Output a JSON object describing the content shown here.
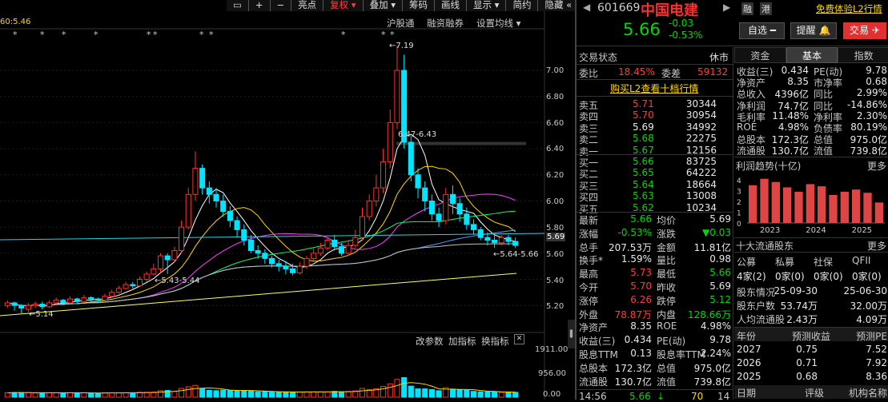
{
  "toolbar": {
    "items": [
      "亮点",
      "复权",
      "叠加",
      "筹码",
      "画线",
      "显示",
      "简约",
      "隐藏"
    ],
    "ma_label": "60:5.46"
  },
  "chart_labels": {
    "high": "7.19",
    "mid": "6.47-6.43",
    "low1": "5.43-5.44",
    "low_price": "5.14",
    "cur_range": "5.64-5.66",
    "current": "5.69"
  },
  "price_axis": [
    "7.00",
    "6.80",
    "6.60",
    "6.40",
    "6.20",
    "6.00",
    "5.80",
    "5.60",
    "5.40",
    "5.20"
  ],
  "vol_axis": [
    "1911.00",
    "956.00",
    "0.00"
  ],
  "right_tabs": [
    "沪股通",
    "融资融券",
    "设置均线"
  ],
  "bottom_tabs": [
    "改参数",
    "加指标",
    "换指标"
  ],
  "stock": {
    "code": "601669",
    "name": "中国电建",
    "price": "5.66",
    "change": "-0.03",
    "pct": "-0.53%",
    "badges": [
      "融",
      "港"
    ],
    "promo": "免费体验L2行情",
    "btn_select": "自选",
    "btn_remind": "提醒",
    "btn_trade": "交易"
  },
  "trade_status": {
    "label": "交易状态",
    "value": "休市"
  },
  "wb": {
    "ratio_label": "委比",
    "ratio": "18.45%",
    "diff_label": "委差",
    "diff": "59132"
  },
  "l2_link": "购买L2查看十档行情",
  "asks": [
    {
      "l": "卖五",
      "p": "5.71",
      "v": "30344"
    },
    {
      "l": "卖四",
      "p": "5.70",
      "v": "30954"
    },
    {
      "l": "卖三",
      "p": "5.69",
      "v": "34992"
    },
    {
      "l": "卖二",
      "p": "5.68",
      "v": "22275"
    },
    {
      "l": "卖一",
      "p": "5.67",
      "v": "12156"
    }
  ],
  "bids": [
    {
      "l": "买一",
      "p": "5.66",
      "v": "83725"
    },
    {
      "l": "买二",
      "p": "5.65",
      "v": "64222"
    },
    {
      "l": "买三",
      "p": "5.64",
      "v": "18664"
    },
    {
      "l": "买四",
      "p": "5.63",
      "v": "13008"
    },
    {
      "l": "买五",
      "p": "5.62",
      "v": "10234"
    }
  ],
  "quote": [
    [
      "最新",
      "5.66",
      "均价",
      "5.69"
    ],
    [
      "涨幅",
      "-0.53%",
      "涨跌",
      "▼0.03"
    ],
    [
      "总手",
      "207.53万",
      "金额",
      "11.81亿"
    ],
    [
      "换手*",
      "1.59%",
      "量比",
      "0.98"
    ],
    [
      "最高",
      "5.73",
      "最低",
      "5.66"
    ],
    [
      "今开",
      "5.70",
      "昨收",
      "5.69"
    ],
    [
      "涨停",
      "6.26",
      "跌停",
      "5.12"
    ],
    [
      "外盘",
      "78.87万",
      "内盘",
      "128.66万"
    ],
    [
      "净资产",
      "8.35",
      "ROE",
      "4.98%"
    ],
    [
      "收益(三)",
      "0.434",
      "PE(动)",
      "9.78"
    ],
    [
      "股息TTM",
      "0.13",
      "股息率TTM",
      "2.24%"
    ],
    [
      "总股本",
      "172.3亿",
      "总值",
      "975.0亿"
    ],
    [
      "流通股",
      "130.7亿",
      "流值",
      "739.8亿"
    ]
  ],
  "tick": {
    "time": "14:56",
    "price": "5.66",
    "vol": "70",
    "n": "14"
  },
  "fund_tabs": [
    "资金",
    "基本",
    "指数"
  ],
  "basic": [
    [
      "收益(三)",
      "0.434",
      "PE(动)",
      "9.78"
    ],
    [
      "净资产",
      "8.35",
      "市净率",
      "0.68"
    ],
    [
      "总收入",
      "4396亿",
      "同比",
      "2.99%"
    ],
    [
      "净利润",
      "74.7亿",
      "同比",
      "-14.86%"
    ],
    [
      "毛利率",
      "11.48%",
      "净利率",
      "2.30%"
    ],
    [
      "ROE",
      "4.98%",
      "负债率",
      "80.19%"
    ],
    [
      "总股本",
      "172.3亿",
      "总值",
      "975.0亿"
    ],
    [
      "流通股",
      "130.7亿",
      "流值",
      "739.8亿"
    ]
  ],
  "profit": {
    "title": "利润趋势(十亿)",
    "more": "更多",
    "years": [
      "2023",
      "2024",
      "2025"
    ],
    "yaxis": [
      "4",
      "3",
      "2",
      "1",
      "0"
    ],
    "bars": [
      3.5,
      4.1,
      3.8,
      3.3,
      2.9,
      3.6,
      3.4,
      2.6,
      2.9,
      3.1,
      2.8,
      1.9
    ]
  },
  "holders": {
    "title": "十大流通股东",
    "more": "更多",
    "cols": [
      "公募",
      "私募",
      "社保",
      "QFII"
    ],
    "vals": [
      "4家(2)",
      "0家(0)",
      "0家(0)",
      "0家(0)"
    ],
    "rows": [
      [
        "股东情况",
        "25-09-30",
        "25-06-30"
      ],
      [
        "股东户数",
        "53.74万",
        "32.00万"
      ],
      [
        "人均流通股",
        "2.43万",
        "4.09万"
      ]
    ]
  },
  "forecast": {
    "cols": [
      "年份",
      "预测收益",
      "预测PE"
    ],
    "rows": [
      [
        "2027",
        "0.75",
        "7.52"
      ],
      [
        "2026",
        "0.71",
        "7.92"
      ],
      [
        "2025",
        "0.68",
        "8.36"
      ]
    ],
    "foot": [
      "日期",
      "评级",
      "机构名称"
    ]
  },
  "chart_data": {
    "type": "candlestick",
    "candles": [
      [
        5.2,
        5.22,
        5.18,
        5.24
      ],
      [
        5.22,
        5.2,
        5.16,
        5.23
      ],
      [
        5.2,
        5.18,
        5.14,
        5.21
      ],
      [
        5.17,
        5.2,
        5.15,
        5.22
      ],
      [
        5.2,
        5.21,
        5.18,
        5.23
      ],
      [
        5.21,
        5.19,
        5.17,
        5.23
      ],
      [
        5.19,
        5.22,
        5.18,
        5.24
      ],
      [
        5.22,
        5.24,
        5.2,
        5.26
      ],
      [
        5.24,
        5.22,
        5.2,
        5.25
      ],
      [
        5.22,
        5.25,
        5.21,
        5.27
      ],
      [
        5.25,
        5.23,
        5.21,
        5.26
      ],
      [
        5.23,
        5.26,
        5.22,
        5.28
      ],
      [
        5.26,
        5.25,
        5.23,
        5.27
      ],
      [
        5.25,
        5.24,
        5.22,
        5.26
      ],
      [
        5.24,
        5.27,
        5.23,
        5.29
      ],
      [
        5.27,
        5.3,
        5.26,
        5.32
      ],
      [
        5.3,
        5.33,
        5.29,
        5.35
      ],
      [
        5.33,
        5.36,
        5.32,
        5.38
      ],
      [
        5.36,
        5.35,
        5.33,
        5.38
      ],
      [
        5.35,
        5.4,
        5.34,
        5.42
      ],
      [
        5.4,
        5.44,
        5.38,
        5.46
      ],
      [
        5.44,
        5.48,
        5.43,
        5.52
      ],
      [
        5.48,
        5.58,
        5.45,
        5.6
      ],
      [
        5.58,
        5.55,
        5.44,
        5.6
      ],
      [
        5.55,
        5.62,
        5.53,
        5.65
      ],
      [
        5.62,
        5.8,
        5.6,
        5.85
      ],
      [
        5.8,
        6.05,
        5.78,
        6.1
      ],
      [
        6.05,
        6.25,
        6.0,
        6.38
      ],
      [
        6.25,
        6.1,
        6.05,
        6.28
      ],
      [
        6.1,
        6.05,
        5.98,
        6.15
      ],
      [
        6.05,
        6.0,
        5.95,
        6.1
      ],
      [
        6.0,
        5.92,
        5.88,
        6.05
      ],
      [
        5.92,
        5.85,
        5.8,
        5.96
      ],
      [
        5.85,
        5.78,
        5.72,
        5.88
      ],
      [
        5.78,
        5.7,
        5.66,
        5.82
      ],
      [
        5.7,
        5.62,
        5.6,
        5.74
      ],
      [
        5.62,
        5.6,
        5.56,
        5.66
      ],
      [
        5.6,
        5.56,
        5.52,
        5.63
      ],
      [
        5.56,
        5.52,
        5.49,
        5.58
      ],
      [
        5.52,
        5.5,
        5.46,
        5.55
      ],
      [
        5.5,
        5.48,
        5.44,
        5.54
      ],
      [
        5.48,
        5.45,
        5.43,
        5.52
      ],
      [
        5.45,
        5.5,
        5.44,
        5.53
      ],
      [
        5.5,
        5.56,
        5.48,
        5.58
      ],
      [
        5.56,
        5.6,
        5.54,
        5.64
      ],
      [
        5.6,
        5.64,
        5.58,
        5.68
      ],
      [
        5.64,
        5.7,
        5.62,
        5.72
      ],
      [
        5.7,
        5.65,
        5.62,
        5.74
      ],
      [
        5.65,
        5.6,
        5.58,
        5.68
      ],
      [
        5.6,
        5.66,
        5.58,
        5.7
      ],
      [
        5.66,
        5.72,
        5.64,
        5.78
      ],
      [
        5.72,
        5.88,
        5.7,
        5.95
      ],
      [
        5.88,
        6.0,
        5.85,
        6.05
      ],
      [
        6.0,
        6.1,
        5.96,
        6.2
      ],
      [
        6.1,
        6.3,
        6.06,
        6.4
      ],
      [
        6.3,
        6.6,
        6.25,
        6.7
      ],
      [
        6.6,
        7.0,
        6.55,
        7.19
      ],
      [
        7.0,
        6.45,
        6.4,
        7.12
      ],
      [
        6.45,
        6.2,
        6.15,
        6.5
      ],
      [
        6.2,
        6.1,
        6.02,
        6.25
      ],
      [
        6.1,
        6.0,
        5.92,
        6.15
      ],
      [
        6.0,
        5.9,
        5.85,
        6.05
      ],
      [
        5.9,
        5.85,
        5.8,
        5.95
      ],
      [
        5.85,
        6.05,
        5.82,
        6.1
      ],
      [
        6.05,
        5.98,
        5.9,
        6.12
      ],
      [
        5.98,
        5.9,
        5.84,
        6.02
      ],
      [
        5.9,
        5.82,
        5.78,
        5.95
      ],
      [
        5.82,
        5.78,
        5.74,
        5.86
      ],
      [
        5.78,
        5.72,
        5.7,
        5.8
      ],
      [
        5.72,
        5.7,
        5.66,
        5.76
      ],
      [
        5.7,
        5.68,
        5.64,
        5.74
      ],
      [
        5.68,
        5.72,
        5.66,
        5.74
      ],
      [
        5.72,
        5.69,
        5.66,
        5.74
      ],
      [
        5.69,
        5.66,
        5.64,
        5.72
      ]
    ],
    "volume_max": 1911
  }
}
